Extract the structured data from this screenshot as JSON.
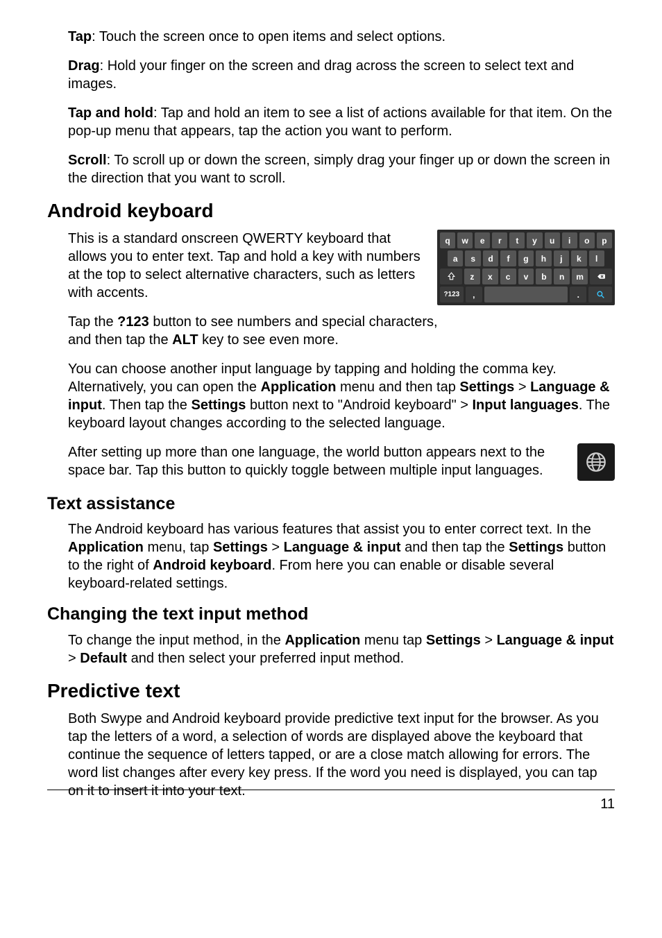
{
  "gestures": {
    "tap": {
      "term": "Tap",
      "desc": ": Touch the screen once to open items and select options."
    },
    "drag": {
      "term": "Drag",
      "desc": ": Hold your finger on the screen and drag across the screen to select text and images."
    },
    "taphold": {
      "term": "Tap and hold",
      "desc": ": Tap and hold an item to see a list of actions available for that item. On the pop-up menu that appears, tap the action you want to perform."
    },
    "scroll": {
      "term": "Scroll",
      "desc": ": To scroll up or down the screen, simply drag your finger up or down the screen in the direction that you want to scroll."
    }
  },
  "androidkb": {
    "heading": "Android keyboard",
    "p1": "This is a standard onscreen QWERTY keyboard that allows you to enter text. Tap and hold a key with numbers at the top to select alternative characters, such as letters with accents.",
    "p2a": "Tap the ",
    "p2b": "?123",
    "p2c": " button to see numbers and special characters, and then tap the ",
    "p2d": "ALT",
    "p2e": " key to see even more.",
    "p3a": "You can choose another input language by tapping and holding the comma key. Alternatively, you can open the ",
    "p3b": "Application",
    "p3c": " menu and then tap ",
    "p3d": "Settings",
    "p3e": " > ",
    "p3f": "Language & input",
    "p3g": ". Then tap the ",
    "p3h": "Settings",
    "p3i": " button next to \"Android keyboard\" > ",
    "p3j": "Input languages",
    "p3k": ". The keyboard layout changes according to the selected language.",
    "p4": "After setting up more than one language, the world button appears next to the space bar. Tap this button to quickly toggle between multiple input languages."
  },
  "textassist": {
    "heading": "Text assistance",
    "p1a": "The Android keyboard has various features that assist you to enter correct text. In the ",
    "p1b": "Application",
    "p1c": " menu, tap ",
    "p1d": "Settings",
    "p1e": " > ",
    "p1f": "Language & input",
    "p1g": " and then tap the ",
    "p1h": "Settings",
    "p1i": " button to the right of ",
    "p1j": "Android keyboard",
    "p1k": ". From here you can enable or disable several keyboard-related settings."
  },
  "changeinput": {
    "heading": "Changing the text input method",
    "p1a": "To change the input method, in the ",
    "p1b": "Application",
    "p1c": " menu tap ",
    "p1d": "Settings",
    "p1e": " > ",
    "p1f": "Language & input",
    "p1g": " > ",
    "p1h": "Default",
    "p1i": " and then select your preferred input method."
  },
  "predictive": {
    "heading": "Predictive text",
    "p1": "Both Swype and Android keyboard provide predictive text input for the browser. As you tap the letters of a word, a selection of words are displayed above the keyboard that continue the sequence of letters tapped, or are a close match allowing for errors. The word list changes after every key press. If the word you need is displayed, you can tap on it to insert it into your text."
  },
  "kbd": {
    "row1": [
      "q",
      "w",
      "e",
      "r",
      "t",
      "y",
      "u",
      "i",
      "o",
      "p"
    ],
    "row2": [
      "a",
      "s",
      "d",
      "f",
      "g",
      "h",
      "j",
      "k",
      "l"
    ],
    "row3": [
      "z",
      "x",
      "c",
      "v",
      "b",
      "n",
      "m"
    ],
    "numkey": "?123",
    "comma": ",",
    "period": "."
  },
  "page_number": "11"
}
